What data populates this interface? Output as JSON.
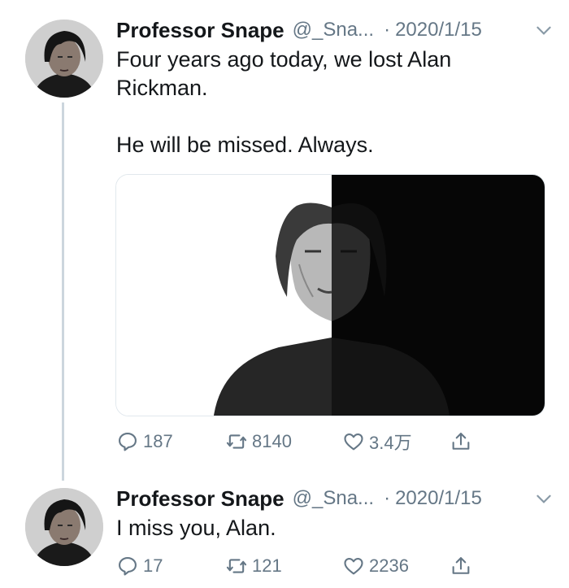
{
  "tweets": [
    {
      "author_name": "Professor Snape",
      "handle": "@_Sna...",
      "separator": "·",
      "date": "2020/1/15",
      "text": "Four years ago today, we lost Alan\nRickman.\n\nHe will be missed. Always.",
      "media": {
        "description_icon": "portrait-photo"
      },
      "actions": {
        "replies": "187",
        "retweets": "8140",
        "likes": "3.4万"
      }
    },
    {
      "author_name": "Professor Snape",
      "handle": "@_Sna...",
      "separator": "·",
      "date": "2020/1/15",
      "text": "I miss you, Alan.",
      "actions": {
        "replies": "17",
        "retweets": "121",
        "likes": "2236"
      }
    }
  ],
  "colors": {
    "text": "#14171a",
    "muted": "#657786",
    "thread_line": "#ccd6dd"
  }
}
